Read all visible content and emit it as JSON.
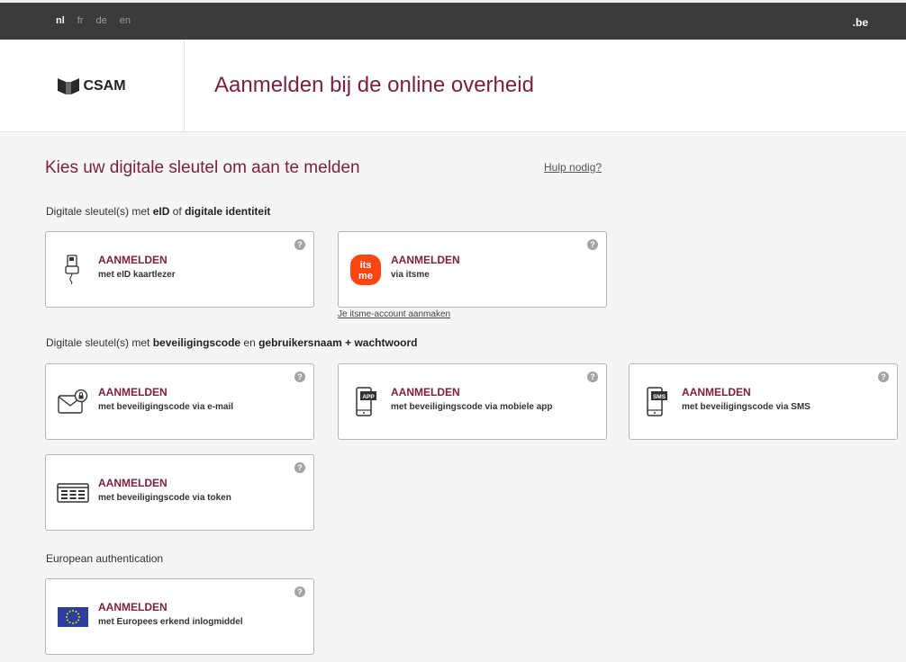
{
  "topbar": {
    "languages": [
      {
        "code": "nl",
        "active": true
      },
      {
        "code": "fr",
        "active": false
      },
      {
        "code": "de",
        "active": false
      },
      {
        "code": "en",
        "active": false
      }
    ],
    "domain": ".be"
  },
  "header": {
    "logo_text": "CSAM",
    "title": "Aanmelden bij de online overheid"
  },
  "main": {
    "choose_title": "Kies uw digitale sleutel om aan te melden",
    "help_link": "Hulp nodig?",
    "sections": [
      {
        "prefix": "Digitale sleutel(s) met ",
        "b1": "eID",
        "mid": " of ",
        "b2": "digitale identiteit"
      },
      {
        "prefix": "Digitale sleutel(s) met ",
        "b1": "beveiligingscode",
        "mid": " en ",
        "b2": "gebruikersnaam + wachtwoord"
      },
      {
        "text": "European authentication"
      }
    ],
    "cards": [
      {
        "title": "AANMELDEN",
        "subtitle": "met eID kaartlezer",
        "icon": "card-reader-icon"
      },
      {
        "title": "AANMELDEN",
        "subtitle": "via itsme",
        "icon": "itsme-icon"
      },
      {
        "title": "AANMELDEN",
        "subtitle": "met beveiligingscode via e-mail",
        "icon": "email-lock-icon"
      },
      {
        "title": "AANMELDEN",
        "subtitle": "met beveiligingscode via mobiele app",
        "icon": "phone-app-icon"
      },
      {
        "title": "AANMELDEN",
        "subtitle": "met beveiligingscode via SMS",
        "icon": "phone-sms-icon"
      },
      {
        "title": "AANMELDEN",
        "subtitle": "met beveiligingscode via token",
        "icon": "token-icon"
      },
      {
        "title": "AANMELDEN",
        "subtitle": "met Europees erkend inlogmiddel",
        "icon": "eu-flag-icon"
      }
    ],
    "help_glyph": "?",
    "itsme_link": "Je itsme-account aanmaken",
    "itsme_logo_text": [
      "its",
      "me"
    ],
    "phone_labels": {
      "app": "APP",
      "sms": "SMS"
    }
  },
  "colors": {
    "accent": "#7b1f3e",
    "topbar": "#3b3b3b",
    "itsme": "#ff4612",
    "eu_blue": "#2b3f9b",
    "eu_gold": "#f5d400"
  }
}
